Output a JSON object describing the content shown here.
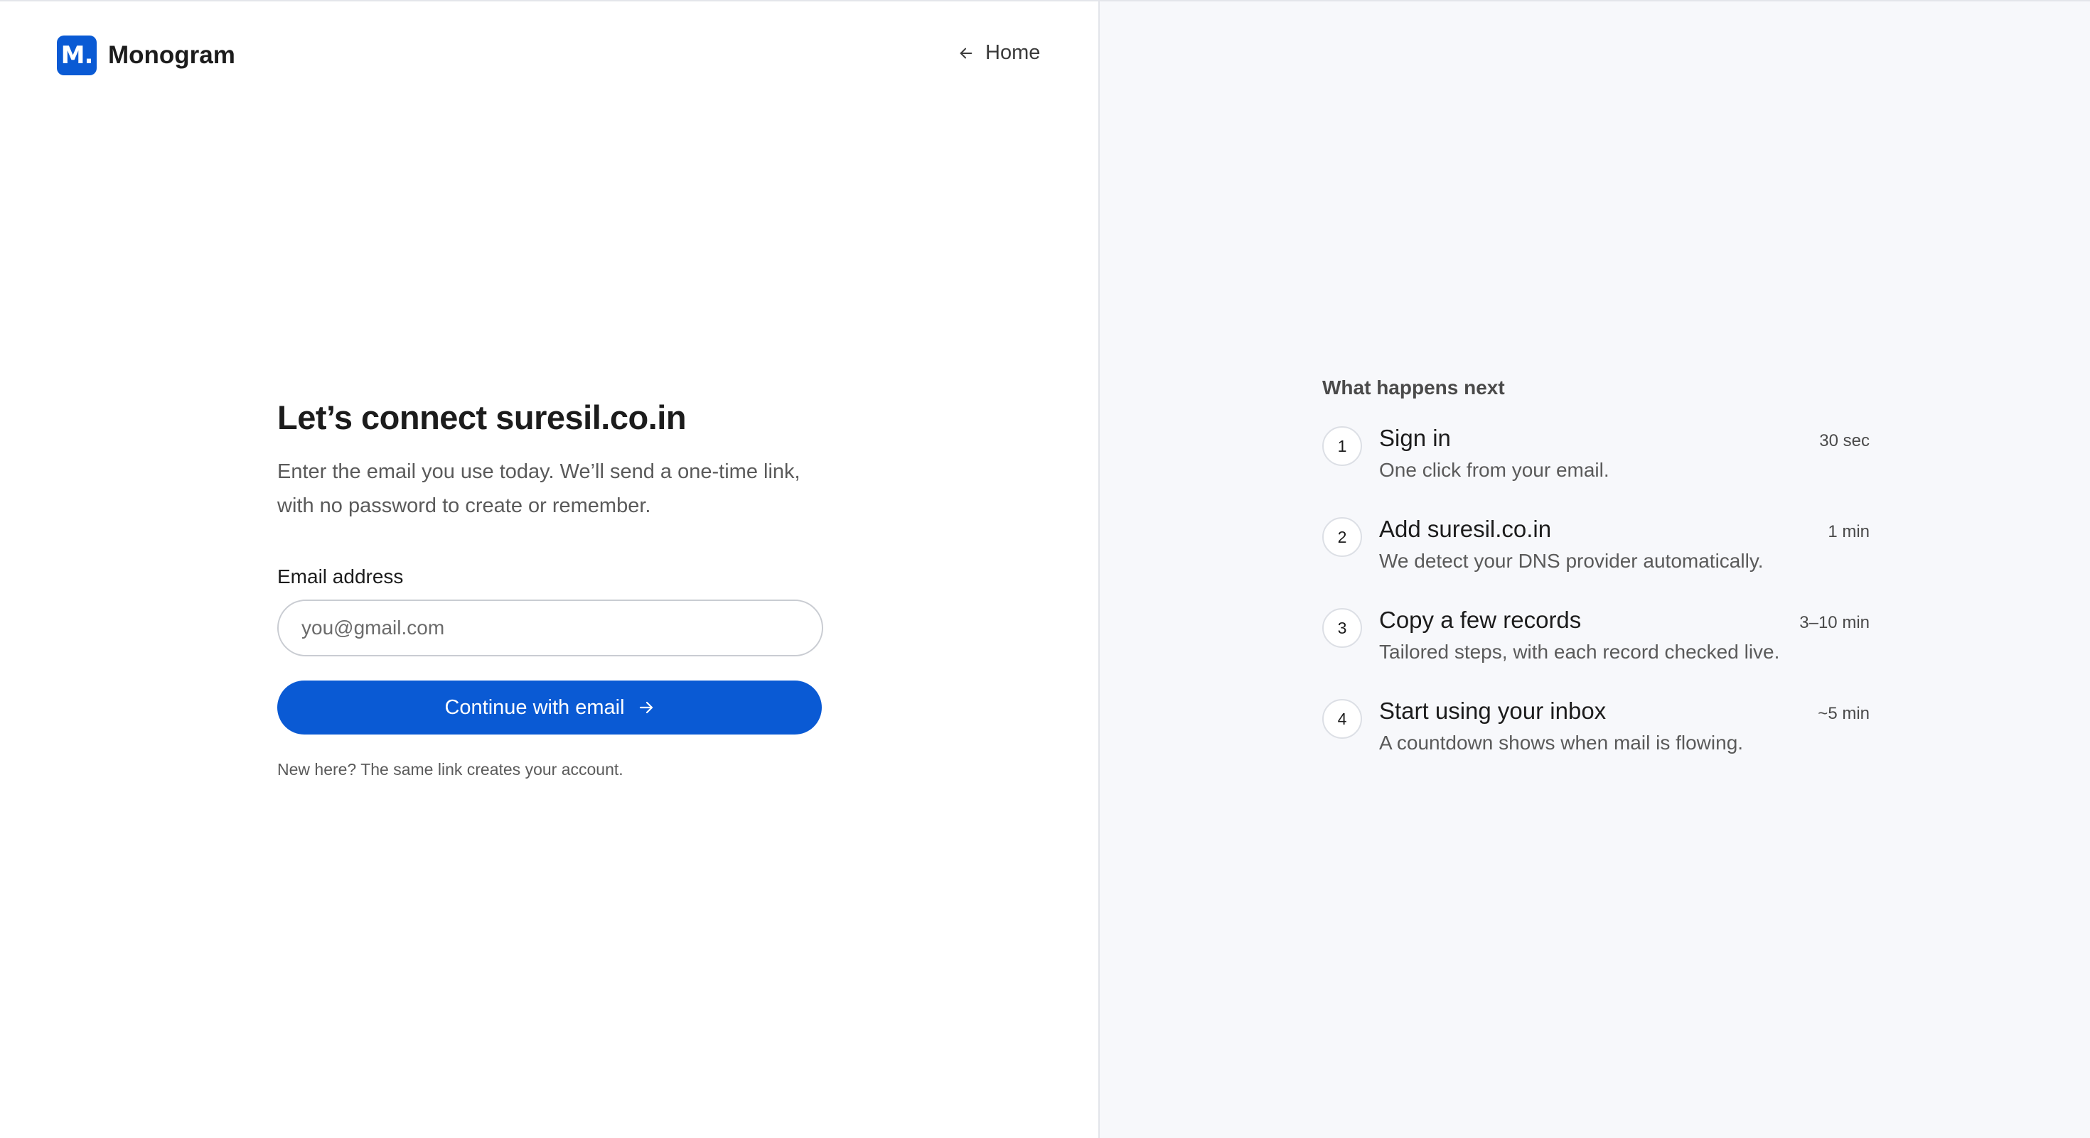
{
  "brand": {
    "logo_letter": "M.",
    "name": "Monogram"
  },
  "nav": {
    "home_label": "Home"
  },
  "form": {
    "title": "Let’s connect suresil.co.in",
    "subtitle": "Enter the email you use today. We’ll send a one-time link, with no password to create or remember.",
    "email_label": "Email address",
    "email_placeholder": "you@gmail.com",
    "email_value": "",
    "continue_label": "Continue with email",
    "footnote": "New here? The same link creates your account."
  },
  "steps": {
    "heading": "What happens next",
    "items": [
      {
        "number": "1",
        "title": "Sign in",
        "time": "30 sec",
        "description": "One click from your email."
      },
      {
        "number": "2",
        "title": "Add suresil.co.in",
        "time": "1 min",
        "description": "We detect your DNS provider automatically."
      },
      {
        "number": "3",
        "title": "Copy a few records",
        "time": "3–10 min",
        "description": "Tailored steps, with each record checked live."
      },
      {
        "number": "4",
        "title": "Start using your inbox",
        "time": "~5 min",
        "description": "A countdown shows when mail is flowing."
      }
    ]
  },
  "colors": {
    "accent": "#0a5ad4",
    "right_panel_bg": "#f7f8fb",
    "divider": "#e3e5ea"
  },
  "icons": {
    "home": "arrow-left-icon",
    "continue": "arrow-right-icon"
  }
}
